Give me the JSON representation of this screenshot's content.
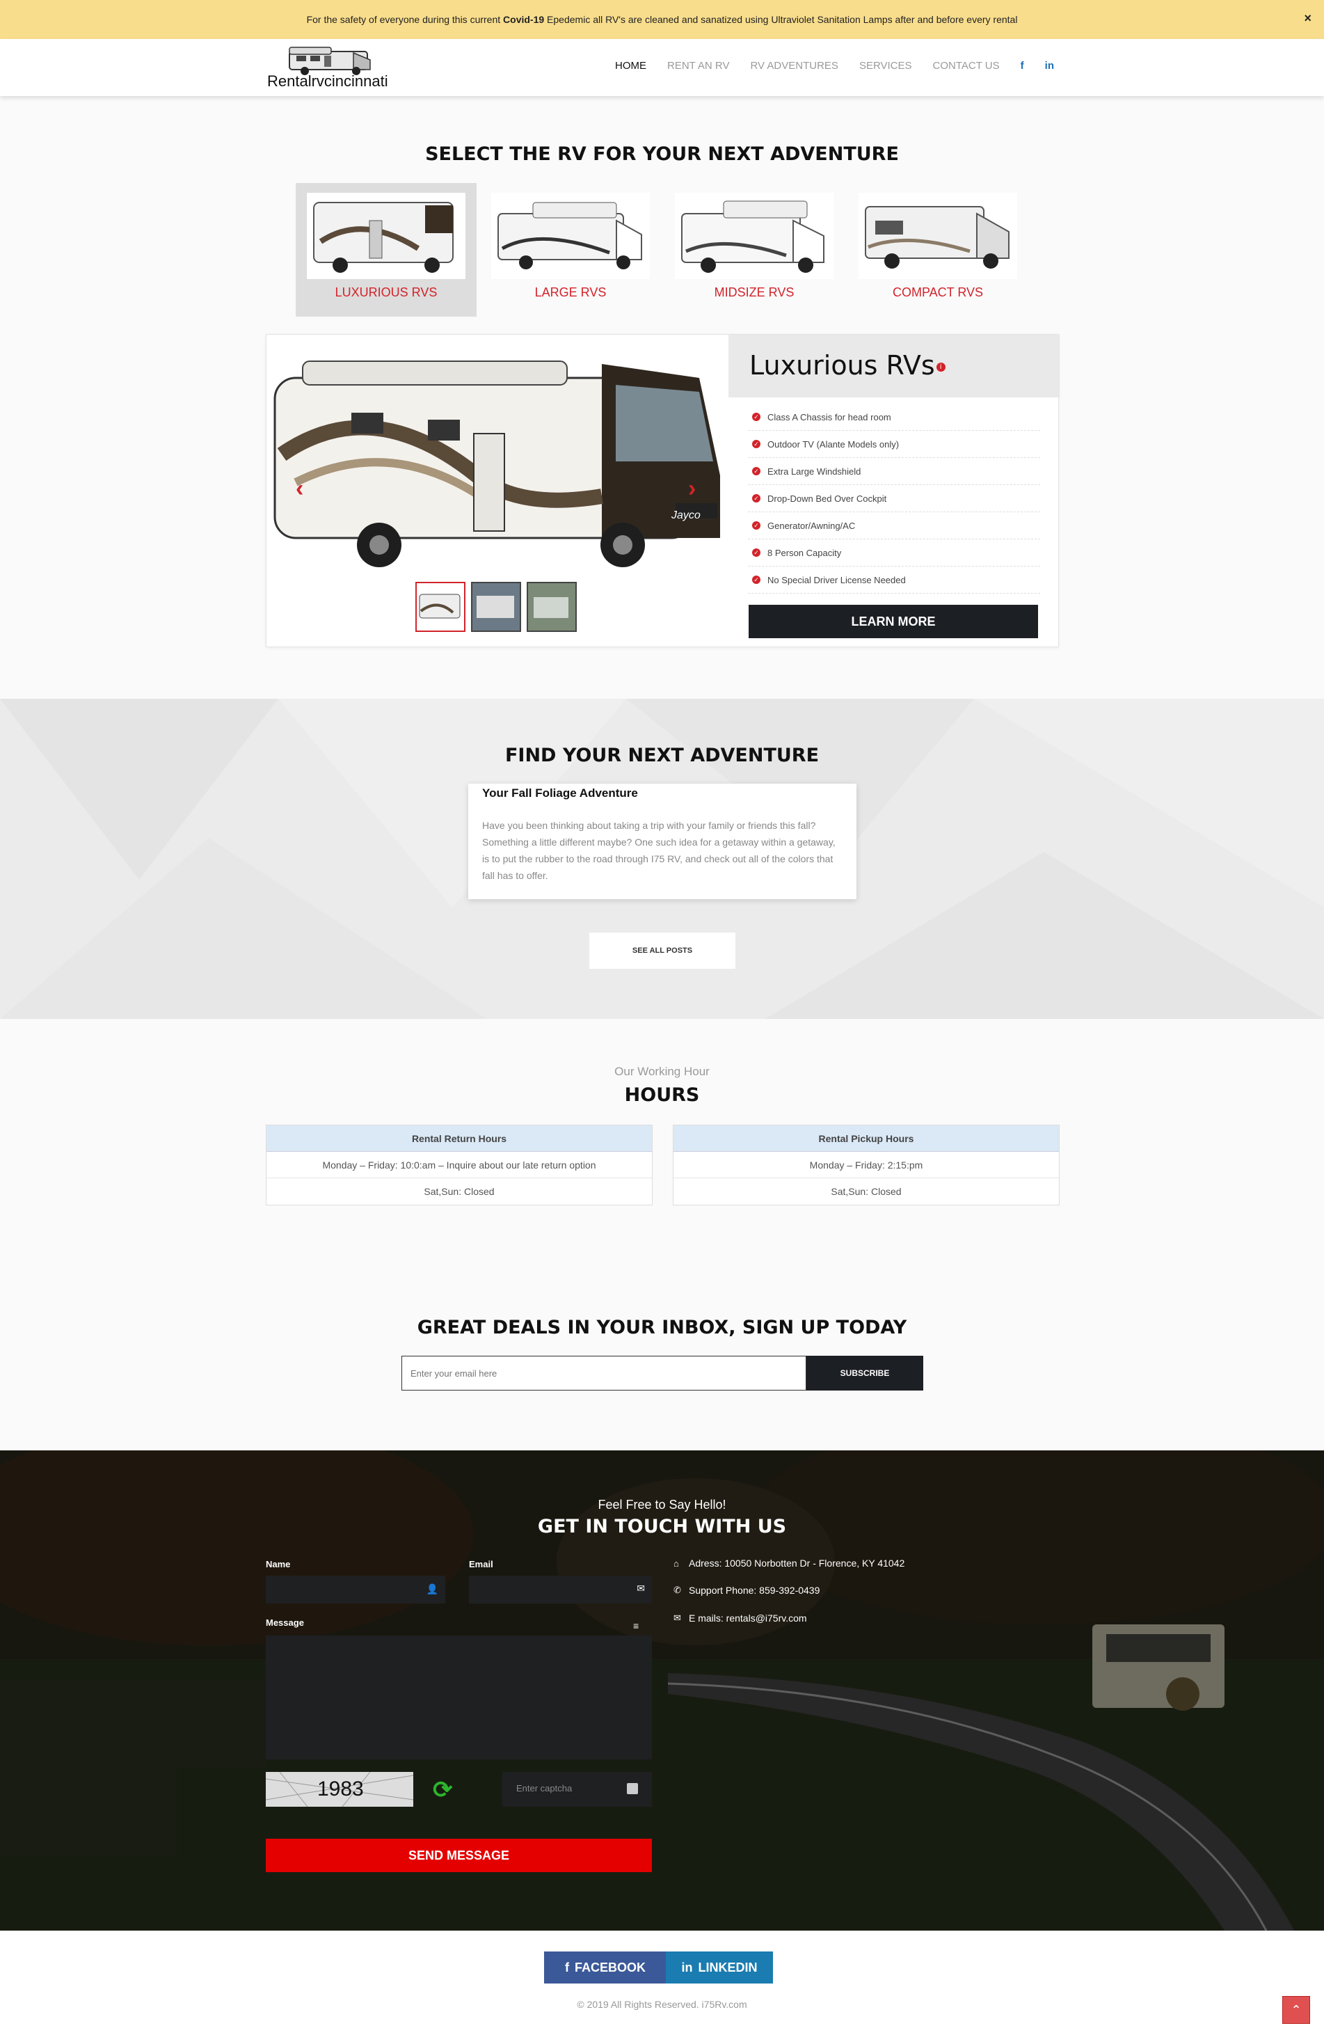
{
  "banner": {
    "prefix": "For the safety of everyone during this current ",
    "bold": "Covid-19",
    "suffix": " Epedemic all RV's are cleaned and sanatized using Ultraviolet Sanitation Lamps after and before every rental",
    "close": "×"
  },
  "header": {
    "logo_text": "Rentalrvcincinnati",
    "nav": [
      "HOME",
      "RENT AN RV",
      "RV ADVENTURES",
      "SERVICES",
      "CONTACT US"
    ],
    "social": [
      "f",
      "in"
    ]
  },
  "select_section": {
    "title": "SELECT THE RV FOR YOUR NEXT ADVENTURE",
    "tabs": [
      "LUXURIOUS RVS",
      "LARGE RVS",
      "MIDSIZE RVS",
      "COMPACT RVS"
    ]
  },
  "feature_card": {
    "title": "Luxurious RVs",
    "features": [
      "Class A Chassis for head room",
      "Outdoor TV (Alante Models only)",
      "Extra Large Windshield",
      "Drop-Down Bed Over Cockpit",
      "Generator/Awning/AC",
      "8 Person Capacity",
      "No Special Driver License Needed"
    ],
    "button": "LEARN MORE",
    "brand": "Jayco"
  },
  "adventure": {
    "title": "FIND YOUR NEXT ADVENTURE",
    "post_title": "Your Fall Foliage Adventure",
    "post_body": "Have you been thinking about taking a trip with your family or friends this fall? Something a little different maybe? One such idea for a getaway within a getaway, is to put the rubber to the road through I75 RV, and check out all of the colors that fall has to offer.",
    "button": "SEE ALL POSTS"
  },
  "hours": {
    "subtitle": "Our Working Hour",
    "title": "HOURS",
    "return": {
      "header": "Rental Return Hours",
      "rows": [
        "Monday – Friday: 10:0:am – Inquire about our late return option",
        "Sat,Sun: Closed"
      ]
    },
    "pickup": {
      "header": "Rental Pickup Hours",
      "rows": [
        "Monday – Friday: 2:15:pm",
        "Sat,Sun: Closed"
      ]
    }
  },
  "newsletter": {
    "title": "GREAT DEALS IN YOUR INBOX, SIGN UP TODAY",
    "placeholder": "Enter your email here",
    "button": "SUBSCRIBE"
  },
  "contact": {
    "subtitle": "Feel Free to Say Hello!",
    "title": "GET IN TOUCH WITH US",
    "name_label": "Name",
    "email_label": "Email",
    "message_label": "Message",
    "captcha_value": "1983",
    "captcha_placeholder": "Enter captcha",
    "send": "SEND MESSAGE",
    "address": "Adress: 10050 Norbotten Dr - Florence, KY 41042",
    "phone": "Support Phone: 859-392-0439",
    "email": "E mails: rentals@i75rv.com"
  },
  "footer": {
    "facebook": "FACEBOOK",
    "linkedin": "LINKEDIN",
    "copyright": "© 2019 All Rights Reserved. i75Rv.com"
  },
  "colors": {
    "accent_red": "#d2232a",
    "banner": "#f8dd8c",
    "dark": "#1c1f24",
    "facebook": "#3b5998",
    "linkedin": "#1a7cb0"
  }
}
